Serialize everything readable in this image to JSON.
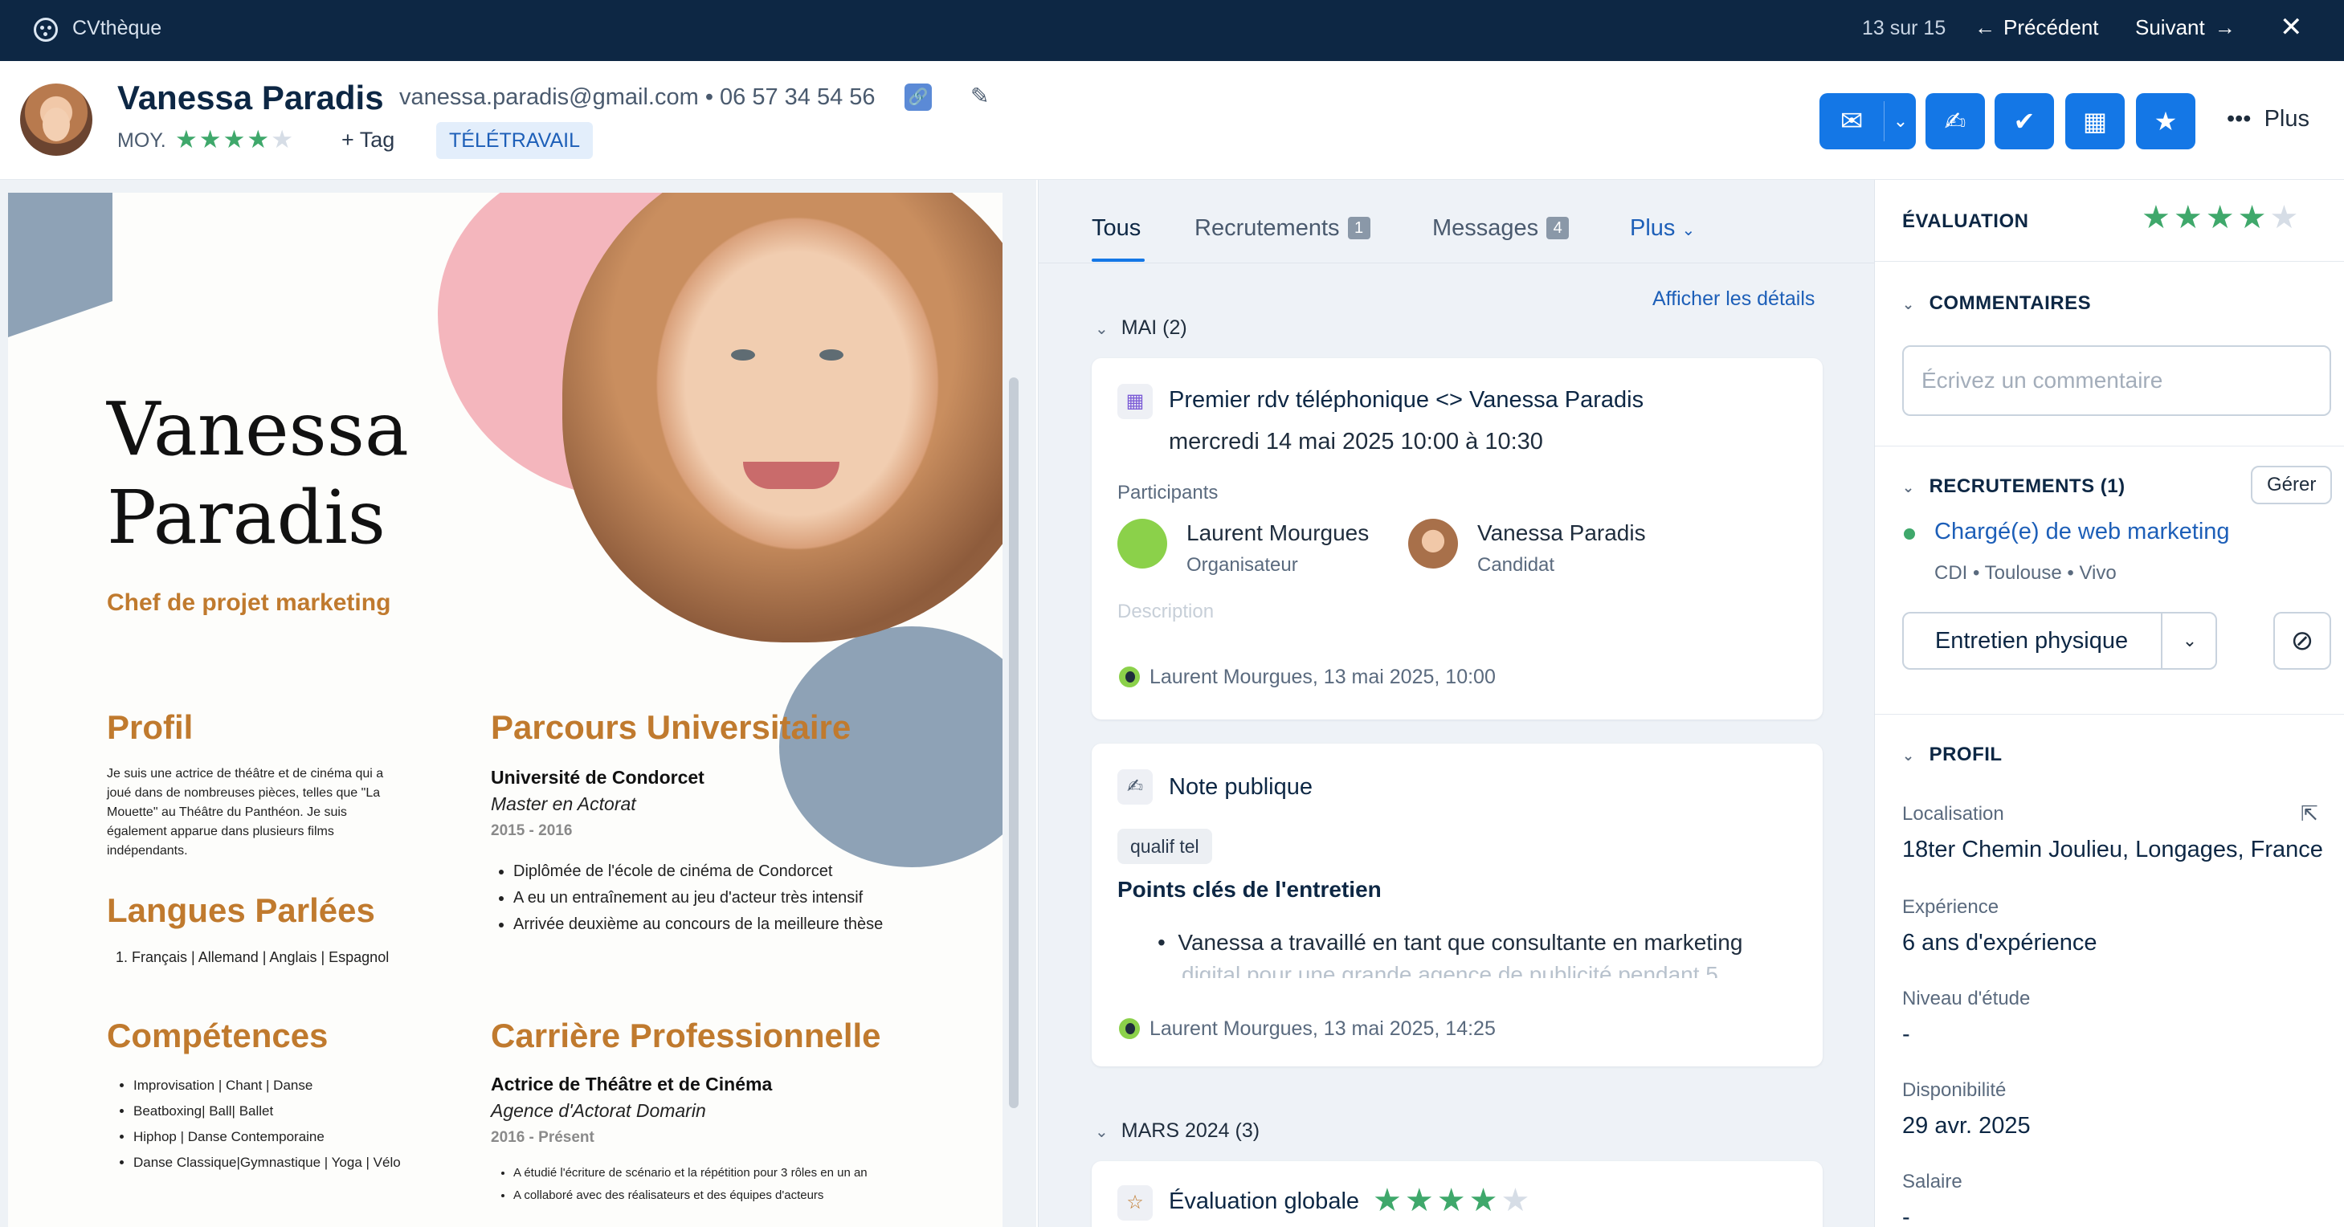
{
  "topbar": {
    "app_title": "CVthèque",
    "pager": "13 sur 15",
    "prev_label": "Précédent",
    "next_label": "Suivant",
    "close_glyph": "✕"
  },
  "candidate": {
    "name": "Vanessa Paradis",
    "contact": "vanessa.paradis@gmail.com • 06 57 34 54 56",
    "level_label": "MOY.",
    "rating": 4,
    "rating_max": 5,
    "add_tag_label": "+ Tag",
    "tag": "TÉLÉTRAVAIL"
  },
  "actions": {
    "more_label": "Plus",
    "icons": [
      "mail-icon",
      "note-icon",
      "check-icon",
      "calendar-icon",
      "star-icon"
    ]
  },
  "cv": {
    "first_name": "Vanessa",
    "last_name": "Paradis",
    "role": "Chef de projet marketing",
    "profil_title": "Profil",
    "profil_text": "Je suis une actrice de théâtre et de cinéma qui a joué dans de nombreuses pièces, telles que \"La Mouette\" au Théâtre du Panthéon. Je suis également apparue dans plusieurs films indépendants.",
    "langues_title": "Langues Parlées",
    "langues_item": "Français | Allemand | Anglais | Espagnol",
    "competences_title": "Compétences",
    "competences": [
      "Improvisation | Chant | Danse",
      "Beatboxing| Ball| Ballet",
      "Hiphop | Danse Contemporaine",
      "Danse Classique|Gymnastique | Yoga | Vélo"
    ],
    "parcours_title": "Parcours Universitaire",
    "parcours_school": "Université de Condorcet",
    "parcours_degree": "Master en Actorat",
    "parcours_dates": "2015 - 2016",
    "parcours_items": [
      "Diplômée de l'école de cinéma de Condorcet",
      "A eu un entraînement au jeu d'acteur très intensif",
      "Arrivée deuxième au concours de la meilleure thèse"
    ],
    "carriere_title": "Carrière Professionnelle",
    "carriere_job": "Actrice de Théâtre et de Cinéma",
    "carriere_company": "Agence d'Actorat Domarin",
    "carriere_dates": "2016 - Présent",
    "carriere_items": [
      "A étudié l'écriture de scénario et la répétition pour 3 rôles en un an",
      "A collaboré avec des réalisateurs et des équipes d'acteurs"
    ]
  },
  "timeline": {
    "tabs": [
      {
        "label": "Tous",
        "badge": ""
      },
      {
        "label": "Recrutements",
        "badge": "1"
      },
      {
        "label": "Messages",
        "badge": "4"
      },
      {
        "label": "Plus",
        "badge": ""
      }
    ],
    "show_details": "Afficher les détails",
    "group1": "MAI (2)",
    "event": {
      "title": "Premier rdv téléphonique <> Vanessa Paradis",
      "when": "mercredi 14 mai 2025 10:00 à 10:30",
      "participants_label": "Participants",
      "p1_name": "Laurent Mourgues",
      "p1_role": "Organisateur",
      "p2_name": "Vanessa Paradis",
      "p2_role": "Candidat",
      "description_label": "Description",
      "footer": "Laurent Mourgues, 13 mai 2025, 10:00"
    },
    "note": {
      "title": "Note publique",
      "chip": "qualif tel",
      "heading": "Points clés de l'entretien",
      "bullet": "Vanessa a travaillé en tant que consultante en marketing",
      "bullet_cont": "digital pour une grande agence de publicité pendant 5",
      "footer": "Laurent Mourgues, 13 mai 2025, 14:25"
    },
    "group2": "MARS 2024 (3)",
    "eval": {
      "title": "Évaluation globale",
      "rating": 4
    }
  },
  "sidebar": {
    "evaluation_title": "ÉVALUATION",
    "evaluation_rating": 4,
    "comments_title": "COMMENTAIRES",
    "comment_placeholder": "Écrivez un commentaire",
    "recrutements_title": "RECRUTEMENTS (1)",
    "manage_label": "Gérer",
    "job_title": "Chargé(e) de web marketing",
    "job_meta": "CDI  • Toulouse  • Vivo",
    "stage": "Entretien physique",
    "profil_title": "PROFIL",
    "fields": [
      {
        "label": "Localisation",
        "value": "18ter Chemin Joulieu, Longages, France"
      },
      {
        "label": "Expérience",
        "value": "6 ans d'expérience"
      },
      {
        "label": "Niveau d'étude",
        "value": "-"
      },
      {
        "label": "Disponibilité",
        "value": "29 avr. 2025"
      },
      {
        "label": "Salaire",
        "value": "-"
      }
    ]
  },
  "colors": {
    "topbar_bg": "#0d2744",
    "accent": "#1477e6",
    "star_on": "#3fa86b",
    "cv_heading": "#c07a2e"
  }
}
